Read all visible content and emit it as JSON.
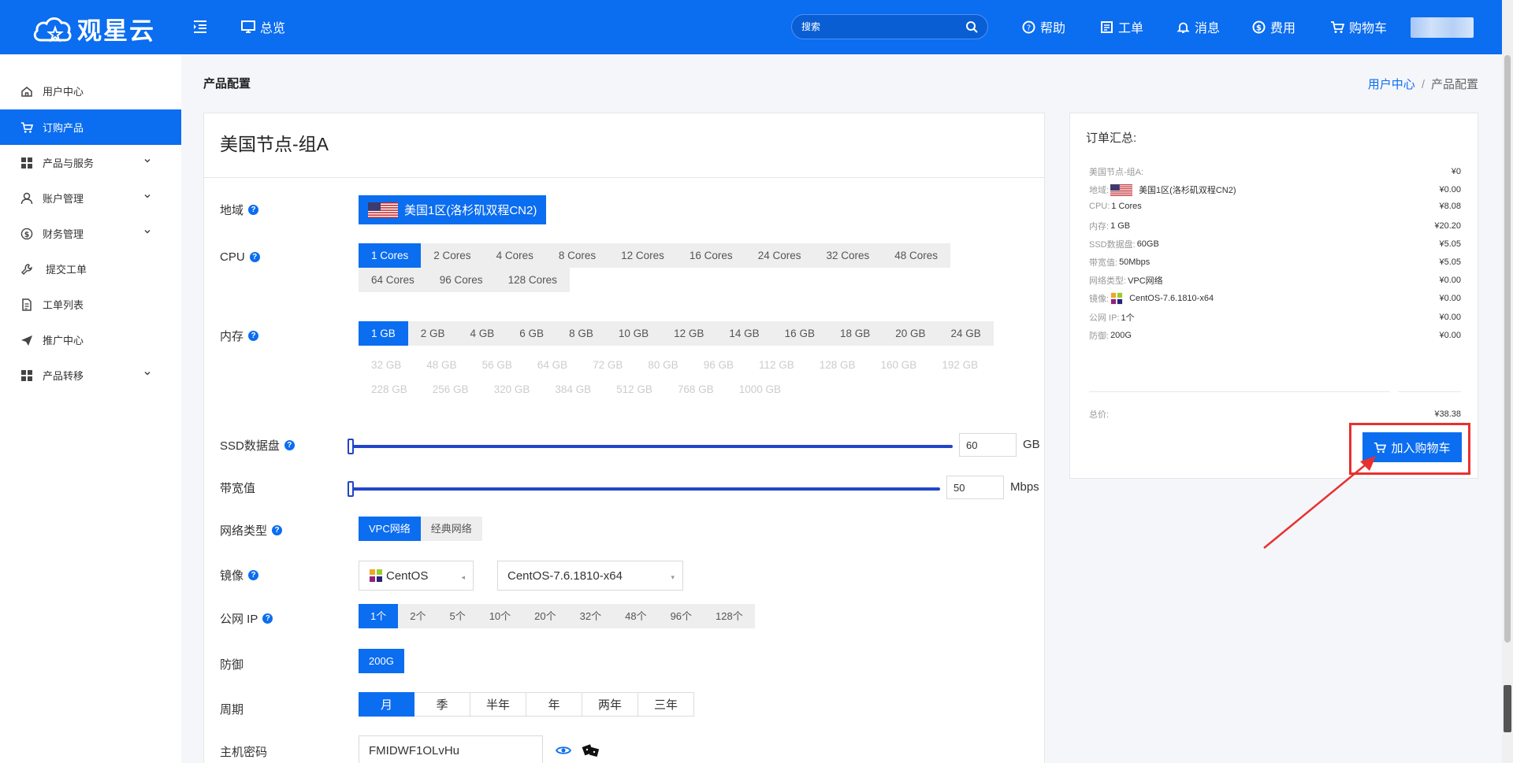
{
  "header": {
    "logo_text": "观星云",
    "overview": "总览",
    "search_placeholder": "搜索",
    "nav": [
      {
        "label": "帮助",
        "icon": "help-circle-icon"
      },
      {
        "label": "工单",
        "icon": "ticket-icon"
      },
      {
        "label": "消息",
        "icon": "bell-icon"
      },
      {
        "label": "费用",
        "icon": "dollar-icon"
      },
      {
        "label": "购物车",
        "icon": "cart-icon"
      }
    ]
  },
  "sidebar": {
    "items": [
      {
        "label": "用户中心",
        "icon": "home-icon"
      },
      {
        "label": "订购产品",
        "icon": "cart-icon",
        "active": true
      },
      {
        "label": "产品与服务",
        "icon": "grid-icon",
        "chevron": true
      },
      {
        "label": "账户管理",
        "icon": "user-icon",
        "chevron": true
      },
      {
        "label": "财务管理",
        "icon": "dollar-icon",
        "chevron": true
      },
      {
        "label": "提交工单",
        "icon": "wrench-icon"
      },
      {
        "label": "工单列表",
        "icon": "document-icon"
      },
      {
        "label": "推广中心",
        "icon": "send-icon"
      },
      {
        "label": "产品转移",
        "icon": "grid-icon",
        "chevron": true
      }
    ]
  },
  "page": {
    "title": "产品配置",
    "breadcrumb": {
      "home": "用户中心",
      "sep": "/",
      "current": "产品配置"
    }
  },
  "config": {
    "product_name": "美国节点-组A",
    "region_label": "地域",
    "region_value": "美国1区(洛杉矶双程CN2)",
    "cpu_label": "CPU",
    "cpu_options": [
      "1 Cores",
      "2 Cores",
      "4 Cores",
      "8 Cores",
      "12 Cores",
      "16 Cores",
      "24 Cores",
      "32 Cores",
      "48 Cores",
      "64 Cores",
      "96 Cores",
      "128 Cores"
    ],
    "memory_label": "内存",
    "memory_options": [
      "1 GB",
      "2 GB",
      "4 GB",
      "6 GB",
      "8 GB",
      "10 GB",
      "12 GB",
      "14 GB",
      "16 GB",
      "18 GB",
      "20 GB",
      "24 GB"
    ],
    "memory_disabled_options": [
      "32 GB",
      "48 GB",
      "56 GB",
      "64 GB",
      "72 GB",
      "80 GB",
      "96 GB",
      "112 GB",
      "128 GB",
      "160 GB",
      "192 GB",
      "228 GB",
      "256 GB",
      "320 GB",
      "384 GB",
      "512 GB",
      "768 GB",
      "1000 GB"
    ],
    "ssd_label": "SSD数据盘",
    "ssd_value": "60",
    "ssd_unit": "GB",
    "bandwidth_label": "带宽值",
    "bandwidth_value": "50",
    "bandwidth_unit": "Mbps",
    "network_label": "网络类型",
    "network_options": [
      "VPC网络",
      "经典网络"
    ],
    "image_label": "镜像",
    "image_os": "CentOS",
    "image_version": "CentOS-7.6.1810-x64",
    "ip_label": "公网 IP",
    "ip_options": [
      "1个",
      "2个",
      "5个",
      "10个",
      "20个",
      "32个",
      "48个",
      "96个",
      "128个"
    ],
    "defense_label": "防御",
    "defense_options": [
      "200G"
    ],
    "period_label": "周期",
    "period_options": [
      "月",
      "季",
      "半年",
      "年",
      "两年",
      "三年"
    ],
    "password_label": "主机密码",
    "password_value": "FMIDWF1OLvHu"
  },
  "summary": {
    "title": "订单汇总:",
    "rows": [
      {
        "key": "美国节点-组A:",
        "value": "",
        "price": "¥0"
      },
      {
        "key": "地域:",
        "value": "美国1区(洛杉矶双程CN2)",
        "price": "¥0.00",
        "flag": true
      },
      {
        "key": "CPU:",
        "value": "1 Cores",
        "price": "¥8.08"
      },
      {
        "key": "内存:",
        "value": "1 GB",
        "price": "¥20.20"
      },
      {
        "key": "SSD数据盘:",
        "value": "60GB",
        "price": "¥5.05"
      },
      {
        "key": "带宽值:",
        "value": "50Mbps",
        "price": "¥5.05"
      },
      {
        "key": "网络类型:",
        "value": "VPC网络",
        "price": "¥0.00"
      },
      {
        "key": "镜像:",
        "value": "CentOS-7.6.1810-x64",
        "price": "¥0.00",
        "os_icon": true
      },
      {
        "key": "公网 IP:",
        "value": "1个",
        "price": "¥0.00"
      },
      {
        "key": "防御:",
        "value": "200G",
        "price": "¥0.00"
      }
    ],
    "total_label": "总价:",
    "total_price": "¥38.38",
    "add_cart_label": "加入购物车"
  },
  "colors": {
    "primary": "#0b6df0",
    "slider": "#2245c8",
    "highlight": "#e8312f"
  }
}
